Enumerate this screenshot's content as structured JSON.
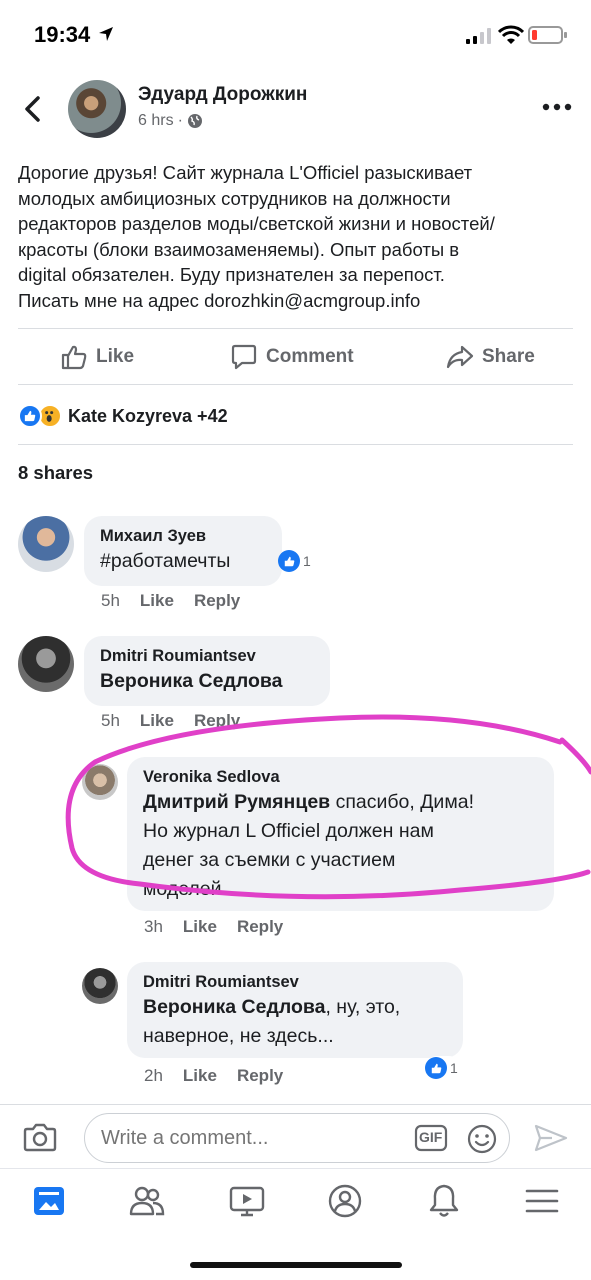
{
  "status_bar": {
    "time": "19:34"
  },
  "post": {
    "author": "Эдуард Дорожкин",
    "time": "6 hrs",
    "dot": "·",
    "text": "Дорогие друзья! Сайт журнала L'Officiel разыскивает\nмолодых амбициозных сотрудников на должности\nредакторов разделов моды/светской жизни и новостей/\nкрасоты (блоки взаимозаменяемы). Опыт работы в\ndigital обязателен. Буду признателен за перепост.\nПисать мне на адрес dorozhkin@acmgroup.info"
  },
  "actions": {
    "like": "Like",
    "comment": "Comment",
    "share": "Share"
  },
  "reactions": {
    "names": "Kate Kozyreva +42"
  },
  "shares": "8 shares",
  "comments": [
    {
      "author": "Михаил Зуев",
      "text": "#работамечты",
      "time": "5h",
      "like": "Like",
      "reply": "Reply",
      "reaction_count": "1"
    },
    {
      "author": "Dmitri Roumiantsev",
      "mention": "Вероника Седлова",
      "time": "5h",
      "like": "Like",
      "reply": "Reply"
    },
    {
      "author": "Veronika Sedlova",
      "mention": "Дмитрий Румянцев",
      "text": " спасибо, Дима!\nНо журнал L Officiel должен нам\nденег за съемки с участием\nмоделей...",
      "time": "3h",
      "like": "Like",
      "reply": "Reply"
    },
    {
      "author": "Dmitri Roumiantsev",
      "mention": "Вероника Седлова",
      "text": ", ну, это,\nнаверное, не здесь...",
      "time": "2h",
      "like": "Like",
      "reply": "Reply",
      "reaction_count": "1"
    }
  ],
  "composer": {
    "placeholder": "Write a comment...",
    "gif": "GIF"
  },
  "colors": {
    "fb_blue": "#1877f2",
    "bubble": "#f0f2f5",
    "secondary_text": "#65676b",
    "ink": "#e040c8",
    "battery_low": "#ff3b30"
  }
}
